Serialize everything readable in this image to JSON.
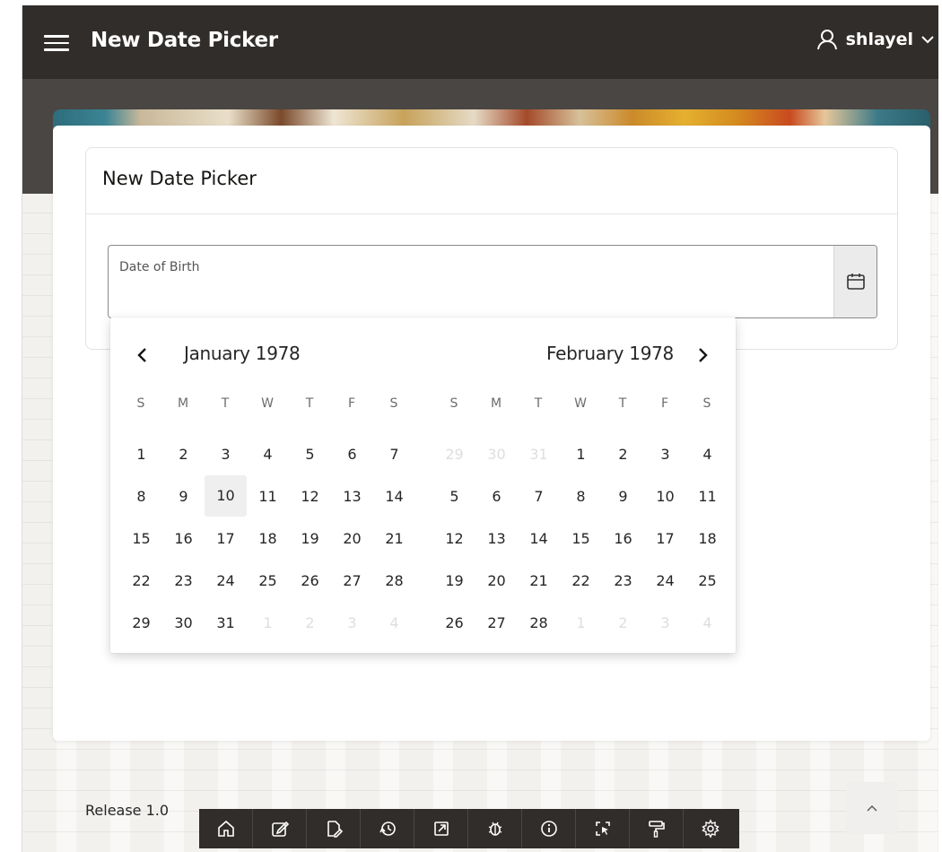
{
  "app": {
    "title": "New Date Picker",
    "user_name": "shlayel"
  },
  "region": {
    "title": "New Date Picker"
  },
  "field": {
    "label": "Date of Birth",
    "value": ""
  },
  "datepicker": {
    "prev_icon": "chevron-left-icon",
    "next_icon": "chevron-right-icon",
    "months": [
      {
        "title": "January 1978",
        "weekdays": [
          "S",
          "M",
          "T",
          "W",
          "T",
          "F",
          "S"
        ],
        "weeks": [
          [
            "1",
            "2",
            "3",
            "4",
            "5",
            "6",
            "7"
          ],
          [
            "8",
            "9",
            "10",
            "11",
            "12",
            "13",
            "14"
          ],
          [
            "15",
            "16",
            "17",
            "18",
            "19",
            "20",
            "21"
          ],
          [
            "22",
            "23",
            "24",
            "25",
            "26",
            "27",
            "28"
          ],
          [
            "29",
            "30",
            "31",
            "1",
            "2",
            "3",
            "4"
          ]
        ],
        "outside": [
          [],
          [],
          [],
          [],
          [
            3,
            4,
            5,
            6
          ]
        ],
        "highlighted": "10"
      },
      {
        "title": "February 1978",
        "weekdays": [
          "S",
          "M",
          "T",
          "W",
          "T",
          "F",
          "S"
        ],
        "weeks": [
          [
            "29",
            "30",
            "31",
            "1",
            "2",
            "3",
            "4"
          ],
          [
            "5",
            "6",
            "7",
            "8",
            "9",
            "10",
            "11"
          ],
          [
            "12",
            "13",
            "14",
            "15",
            "16",
            "17",
            "18"
          ],
          [
            "19",
            "20",
            "21",
            "22",
            "23",
            "24",
            "25"
          ],
          [
            "26",
            "27",
            "28",
            "1",
            "2",
            "3",
            "4"
          ]
        ],
        "outside": [
          [
            0,
            1,
            2
          ],
          [],
          [],
          [],
          [
            3,
            4,
            5,
            6
          ]
        ],
        "highlighted": ""
      }
    ]
  },
  "footer": {
    "release": "Release 1.0"
  },
  "developer_toolbar": {
    "tools": [
      "home-icon",
      "edit-page-icon",
      "edit-doc-icon",
      "session-icon",
      "open-external-icon",
      "debug-bug-icon",
      "info-icon",
      "quick-edit-icon",
      "theme-roller-icon",
      "settings-gear-icon"
    ]
  },
  "colors": {
    "header_bg": "#312d2a",
    "hero_band": "#4a4643",
    "panel_bg": "#ffffff",
    "today_bg": "#efefef"
  }
}
